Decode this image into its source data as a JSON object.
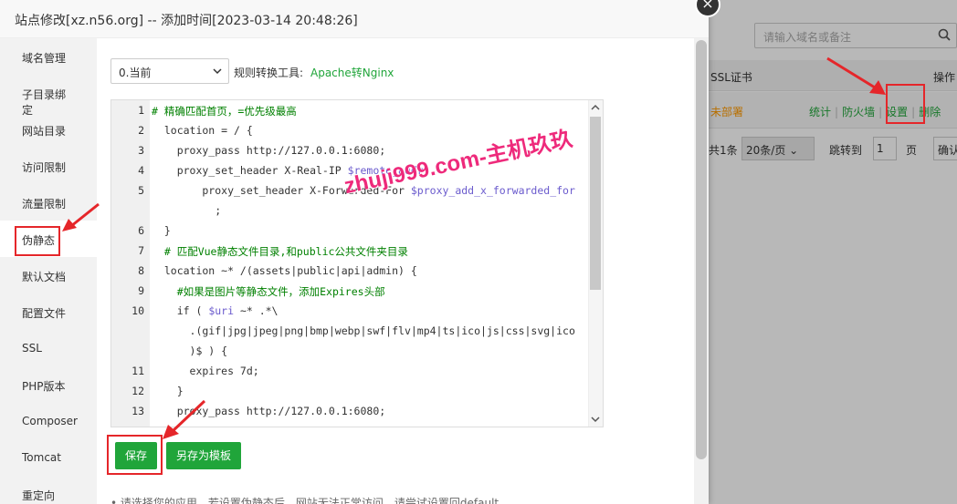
{
  "dialog": {
    "title": "站点修改[xz.n56.org] -- 添加时间[2023-03-14 20:48:26]",
    "close_glyph": "×"
  },
  "sidebar": {
    "items": [
      {
        "label": "域名管理"
      },
      {
        "label": "子目录绑定"
      },
      {
        "label": "网站目录"
      },
      {
        "label": "访问限制"
      },
      {
        "label": "流量限制"
      },
      {
        "label": "伪静态",
        "active": true
      },
      {
        "label": "默认文档"
      },
      {
        "label": "配置文件"
      },
      {
        "label": "SSL"
      },
      {
        "label": "PHP版本"
      },
      {
        "label": "Composer"
      },
      {
        "label": "Tomcat"
      },
      {
        "label": "重定向"
      }
    ]
  },
  "rewrite": {
    "version_select": "0.当前",
    "tool_label": "规则转换工具:",
    "tool_link": "Apache转Nginx",
    "code_lines": [
      {
        "n": "1",
        "text": "# 精确匹配首页，=优先级最高"
      },
      {
        "n": "2",
        "text": "  location = / {"
      },
      {
        "n": "3",
        "text": "    proxy_pass http://127.0.0.1:6080;"
      },
      {
        "n": "4",
        "text": "    proxy_set_header X-Real-IP $remote_addr;"
      },
      {
        "n": "5",
        "text": "        proxy_set_header X-Forwarded-For $proxy_add_x_forwarded_for"
      },
      {
        "n": "",
        "text": "          ;"
      },
      {
        "n": "6",
        "text": "  }"
      },
      {
        "n": "7",
        "text": "  # 匹配Vue静态文件目录,和public公共文件夹目录"
      },
      {
        "n": "8",
        "text": "  location ~* /(assets|public|api|admin) {"
      },
      {
        "n": "9",
        "text": "    #如果是图片等静态文件，添加Expires头部"
      },
      {
        "n": "10",
        "text": "    if ( $uri ~* .*\\"
      },
      {
        "n": "",
        "text": "      .(gif|jpg|jpeg|png|bmp|webp|swf|flv|mp4|ts|ico|js|css|svg|ico"
      },
      {
        "n": "",
        "text": "      )$ ) {"
      },
      {
        "n": "11",
        "text": "      expires 7d;"
      },
      {
        "n": "12",
        "text": "    }"
      },
      {
        "n": "13",
        "text": "    proxy_pass http://127.0.0.1:6080;"
      }
    ],
    "watermark": "zhuji999.com-主机玖玖",
    "save_label": "保存",
    "save_template_label": "另存为模板",
    "tips": "• 请选择您的应用，若设置伪静态后，网站无法正常访问，请尝试设置回default"
  },
  "background": {
    "search_placeholder": "请输入域名或备注",
    "col_ssl": "SSL证书",
    "col_ops": "操作",
    "status": "未部署",
    "links": [
      "统计",
      "防火墙",
      "设置",
      "删除"
    ],
    "pager_total": "共1条",
    "pager_per": "20条/页",
    "pager_jump": "跳转到",
    "pager_page": "1",
    "pager_page_label": "页",
    "pager_ok": "确认"
  },
  "colors": {
    "accent": "#20a53a",
    "annotation": "#e5262a",
    "watermark": "#ee2a7b",
    "status_warning": "#ff9a00"
  }
}
